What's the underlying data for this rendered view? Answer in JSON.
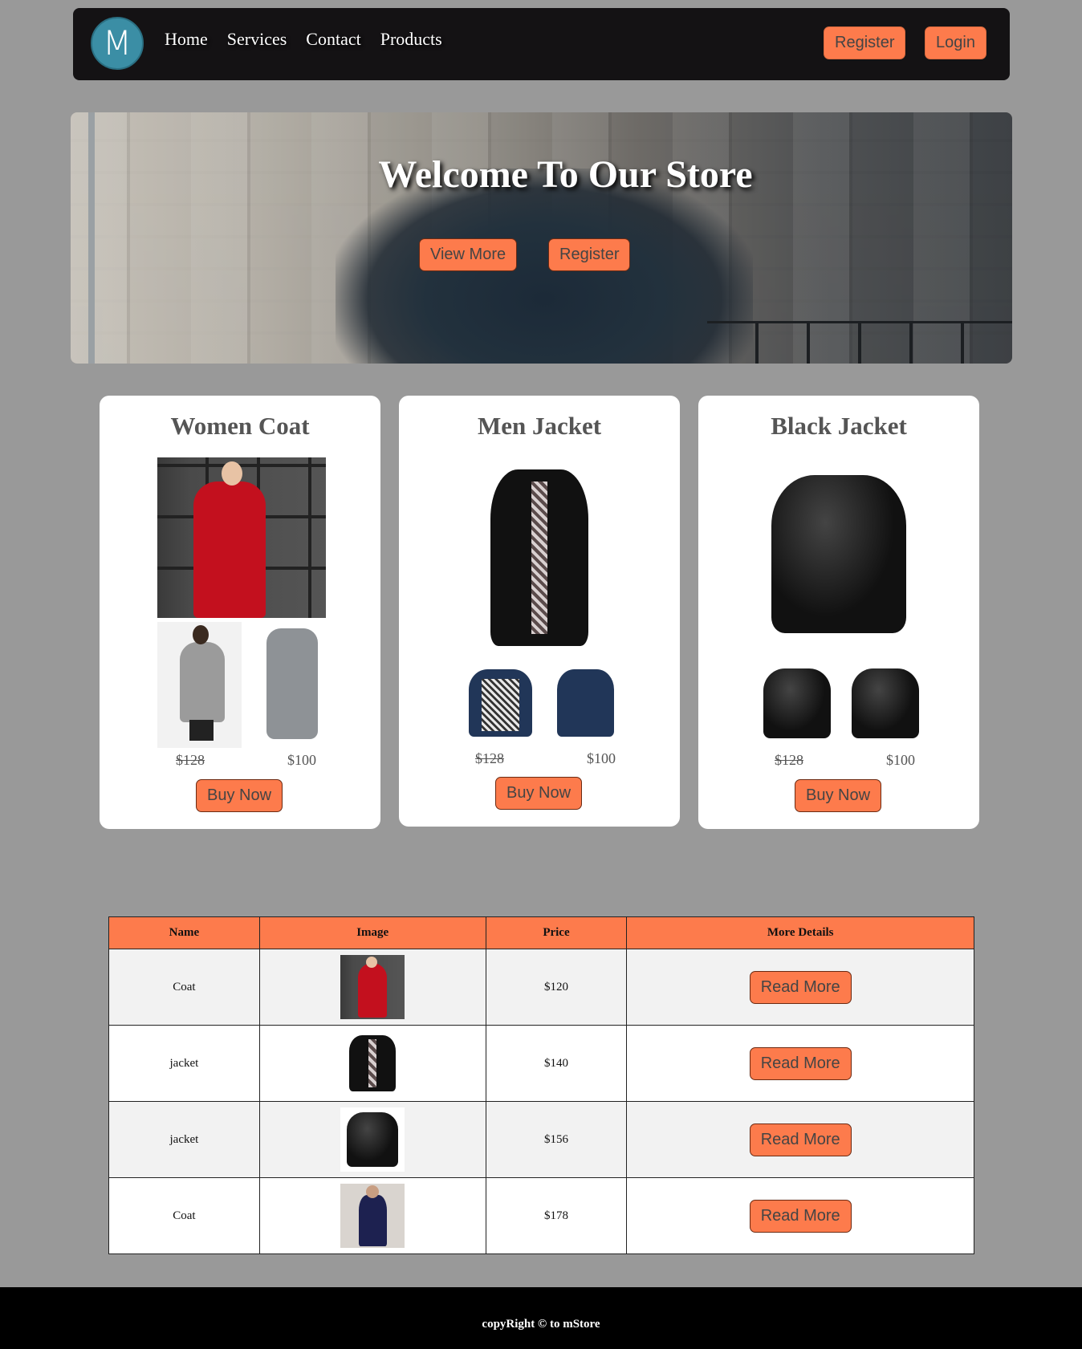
{
  "navbar": {
    "logo_letter": "M",
    "links": [
      "Home",
      "Services",
      "Contact",
      "Products"
    ],
    "register_label": "Register",
    "login_label": "Login"
  },
  "hero": {
    "title": "Welcome To Our Store",
    "view_more_label": "View More",
    "register_label": "Register"
  },
  "cards": [
    {
      "title": "Women Coat",
      "old_price": "$128",
      "new_price": "$100",
      "buy_label": "Buy Now"
    },
    {
      "title": "Men Jacket",
      "old_price": "$128",
      "new_price": "$100",
      "buy_label": "Buy Now"
    },
    {
      "title": "Black Jacket",
      "old_price": "$128",
      "new_price": "$100",
      "buy_label": "Buy Now"
    }
  ],
  "table": {
    "headers": [
      "Name",
      "Image",
      "Price",
      "More Details"
    ],
    "rows": [
      {
        "name": "Coat",
        "image": "red-coat",
        "price": "$120",
        "action": "Read More"
      },
      {
        "name": "jacket",
        "image": "black-jacket",
        "price": "$140",
        "action": "Read More"
      },
      {
        "name": "jacket",
        "image": "leather-jacket",
        "price": "$156",
        "action": "Read More"
      },
      {
        "name": "Coat",
        "image": "navy-coat",
        "price": "$178",
        "action": "Read More"
      }
    ]
  },
  "footer": {
    "text": "copyRight © to mStore"
  },
  "colors": {
    "accent": "#fd7b4c",
    "page_bg": "#999999",
    "nav_bg": "#141214",
    "logo_bg": "#3b8ea5"
  }
}
